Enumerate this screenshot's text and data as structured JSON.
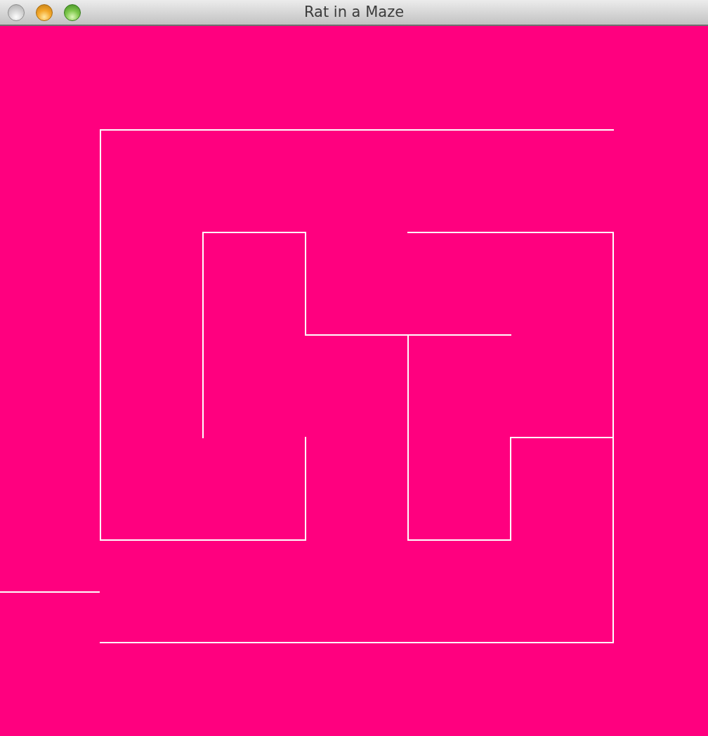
{
  "window": {
    "title": "Rat in a Maze",
    "controls": [
      {
        "kind": "close",
        "disabled": true
      },
      {
        "kind": "minimize",
        "disabled": false
      },
      {
        "kind": "zoom",
        "disabled": false
      }
    ]
  }
}
